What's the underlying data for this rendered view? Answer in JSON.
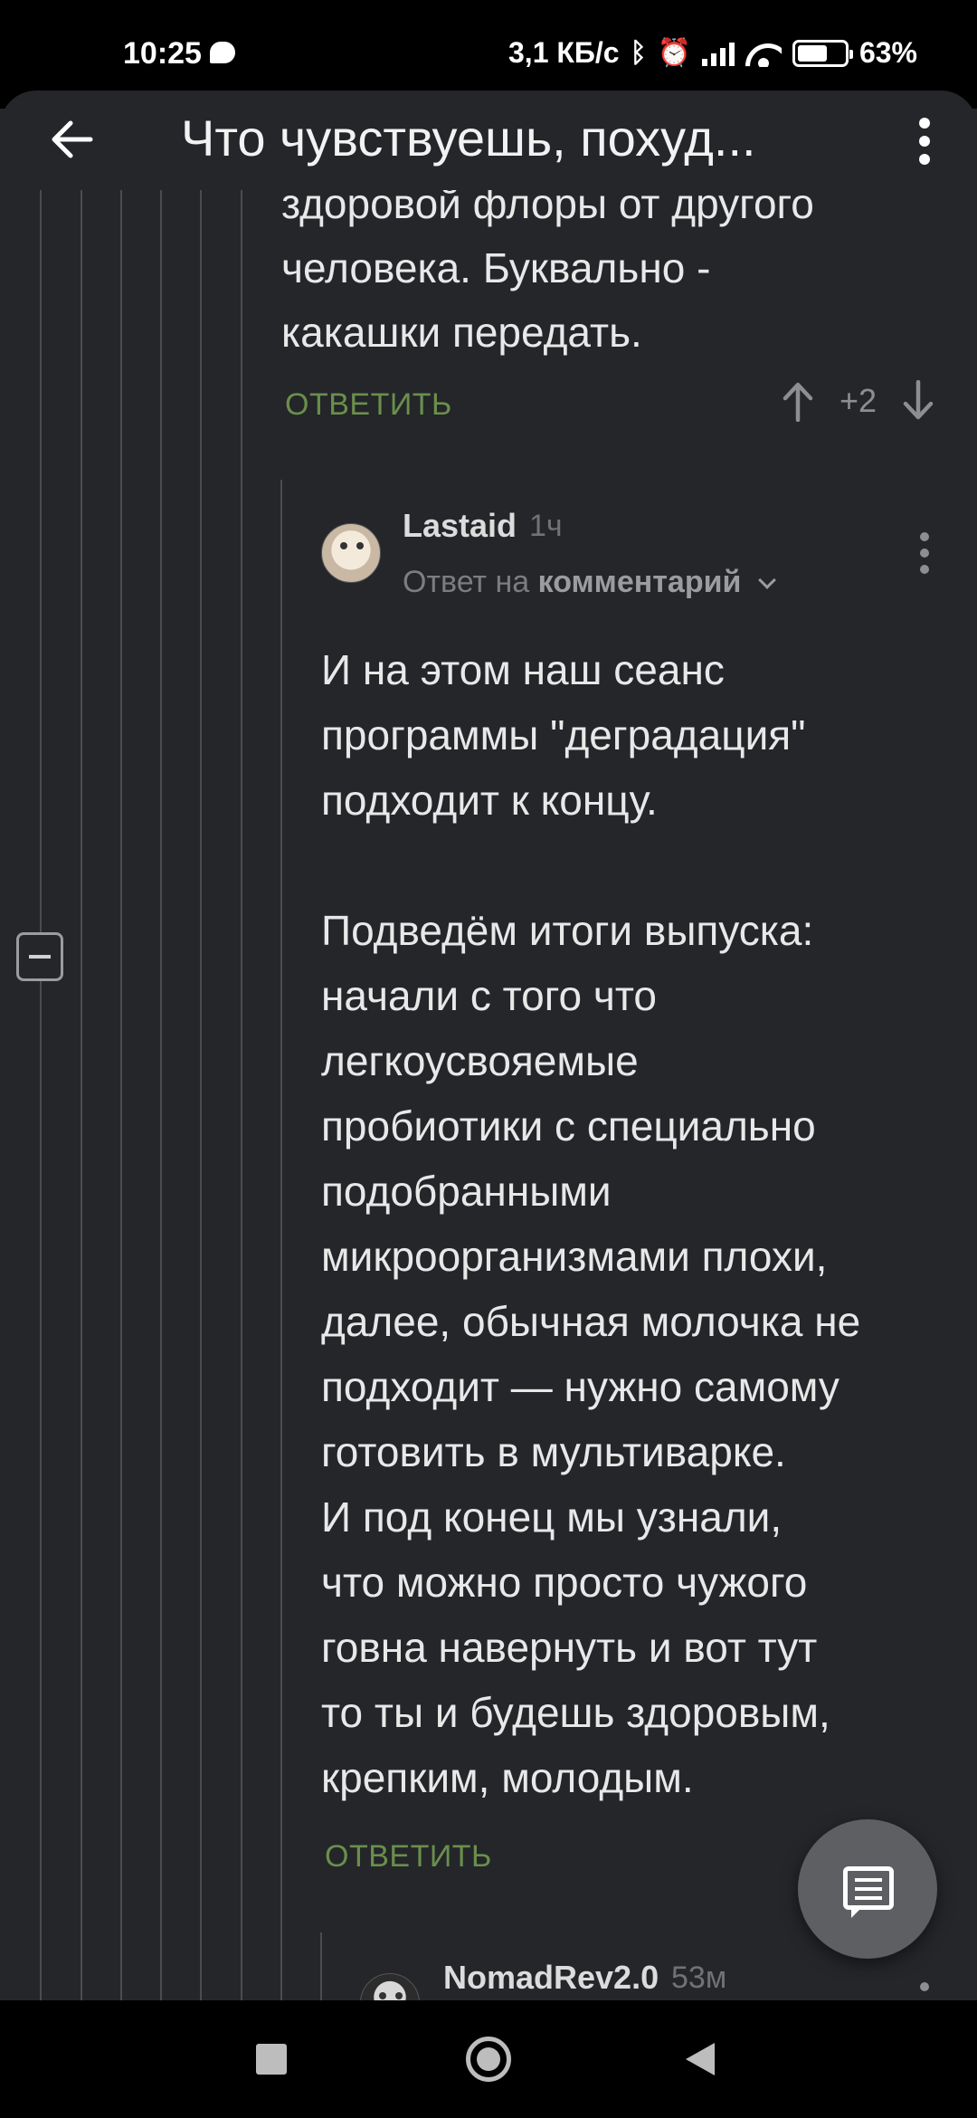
{
  "status_bar": {
    "time": "10:25",
    "net_speed": "3,1 КБ/с",
    "battery": "63%",
    "battery_level": 0.63
  },
  "app_bar": {
    "title": "Что чувствуешь, похуд..."
  },
  "comments": [
    {
      "text": "здоровой флоры от другого\nчеловека. Буквально -\nкакашки передать.",
      "reply_label": "ОТВЕТИТЬ",
      "score": "+2"
    },
    {
      "author": "Lastaid",
      "time": "1ч",
      "reply_to_prefix": "Ответ на",
      "reply_to_target": "комментарий",
      "text": "И на этом наш сеанс\nпрограммы \"деградация\"\nподходит к концу.\n\nПодведём итоги выпуска:\nначали с того что\nлегкоусвояемые\nпробиотики с специально\nподобранными\nмикроорганизмами плохи,\nдалее, обычная молочка не\nподходит — нужно самому\nготовить в мультиварке.\nИ под конец мы узнали,\nчто можно просто чужого\nговна навернуть и вот тут\nто ты и будешь здоровым,\nкрепким, молодым.",
      "reply_label": "ОТВЕТИТЬ"
    },
    {
      "author": "NomadRev2.0",
      "time": "53м"
    }
  ],
  "colors": {
    "background": "#24262a",
    "reply_link": "#6a8f4c",
    "thread_line": "#4a4c51"
  },
  "icons": {
    "back": "arrow-left-icon",
    "menu": "more-vert-icon",
    "collapse": "minus-box-icon",
    "fab": "comment-icon"
  }
}
